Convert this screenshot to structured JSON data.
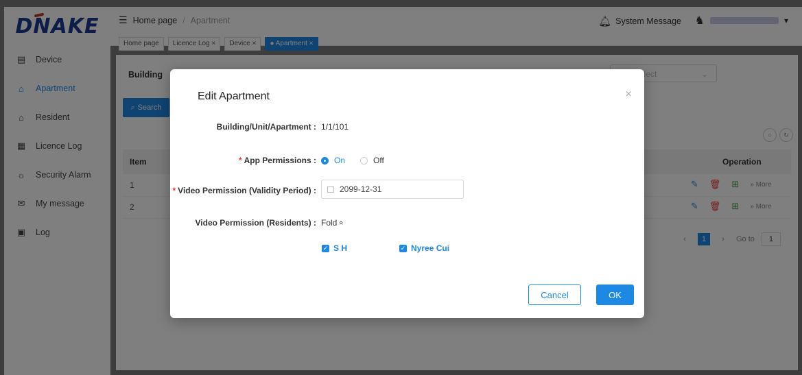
{
  "brand": {
    "logo": "DNAKE",
    "accent": "#1e88e5",
    "logo_color": "#1a3a8f"
  },
  "sidebar": {
    "items": [
      {
        "label": "Device",
        "icon": "device-icon"
      },
      {
        "label": "Apartment",
        "icon": "apartment-icon",
        "active": true
      },
      {
        "label": "Resident",
        "icon": "home-icon"
      },
      {
        "label": "Licence Log",
        "icon": "licence-icon"
      },
      {
        "label": "Security Alarm",
        "icon": "alarm-icon"
      },
      {
        "label": "My message",
        "icon": "message-icon"
      },
      {
        "label": "Log",
        "icon": "log-icon"
      }
    ]
  },
  "header": {
    "breadcrumb": {
      "home": "Home page",
      "separator": "/",
      "current": "Apartment"
    },
    "tabs": [
      {
        "label": "Home page"
      },
      {
        "label": "Licence Log",
        "close": "×"
      },
      {
        "label": "Device",
        "close": "×"
      },
      {
        "label": "● Apartment",
        "close": "×",
        "active": true
      }
    ],
    "system_message": "System Message"
  },
  "filters": {
    "building_label": "Building",
    "select_placeholder": "elect",
    "search_label": "Search"
  },
  "table": {
    "headers": {
      "item": "Item",
      "operation": "Operation"
    },
    "rows": [
      {
        "item": "1",
        "more": "» More"
      },
      {
        "item": "2",
        "more": "» More"
      }
    ]
  },
  "pagination": {
    "current": "1",
    "goto_label": "Go to",
    "goto_value": "1"
  },
  "modal": {
    "title": "Edit Apartment",
    "close": "×",
    "fields": {
      "building": {
        "label": "Building/Unit/Apartment :",
        "value": "1/1/101"
      },
      "app_permissions": {
        "label": "App Permissions :",
        "required": "*",
        "on": "On",
        "off": "Off",
        "selected": "On"
      },
      "video_validity": {
        "label": "Video Permission (Validity Period) :",
        "required": "*",
        "value": "2099-12-31"
      },
      "video_residents": {
        "label": "Video Permission (Residents) :",
        "fold": "Fold",
        "fold_icon": "«"
      },
      "residents": [
        {
          "name": "S H",
          "checked": true
        },
        {
          "name": "Nyree Cui",
          "checked": true
        }
      ]
    },
    "cancel_label": "Cancel",
    "ok_label": "OK"
  }
}
